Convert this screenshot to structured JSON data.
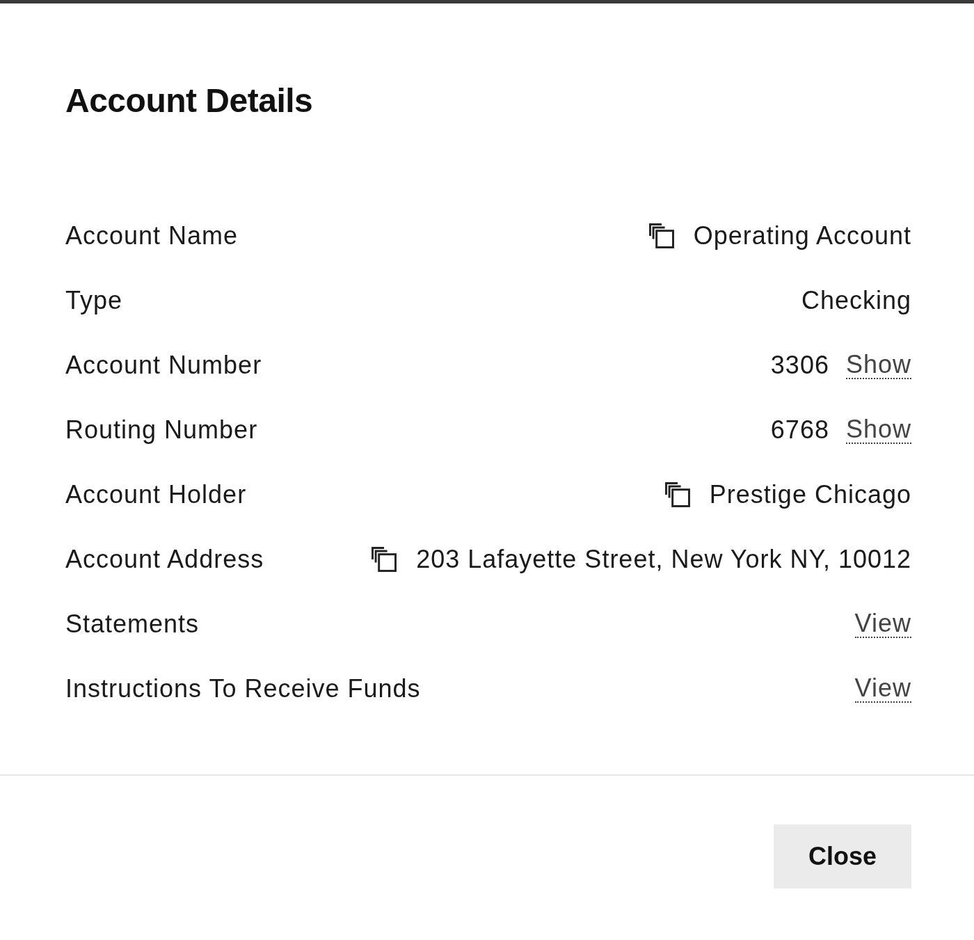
{
  "dialog": {
    "title": "Account Details",
    "rows": [
      {
        "label": "Account Name",
        "kind": "copy",
        "value": "Operating Account"
      },
      {
        "label": "Type",
        "kind": "text",
        "value": "Checking"
      },
      {
        "label": "Account Number",
        "kind": "masked",
        "value": "3306",
        "action": "Show"
      },
      {
        "label": "Routing Number",
        "kind": "masked",
        "value": "6768",
        "action": "Show"
      },
      {
        "label": "Account Holder",
        "kind": "copy",
        "value": "Prestige Chicago"
      },
      {
        "label": "Account Address",
        "kind": "copy",
        "value": "203 Lafayette Street, New York NY, 10012"
      },
      {
        "label": "Statements",
        "kind": "link",
        "action": "View"
      },
      {
        "label": "Instructions To Receive Funds",
        "kind": "link",
        "action": "View"
      }
    ],
    "buttons": [
      "Close"
    ]
  }
}
